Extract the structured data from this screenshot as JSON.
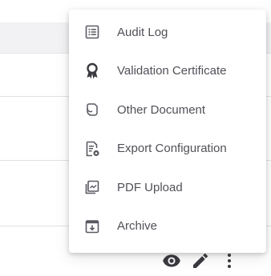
{
  "menu": {
    "items": [
      {
        "label": "Audit Log",
        "icon": "list-icon"
      },
      {
        "label": "Validation Certificate",
        "icon": "certificate-icon"
      },
      {
        "label": "Other Document",
        "icon": "document-icon"
      },
      {
        "label": "Export Configuration",
        "icon": "export-config-icon"
      },
      {
        "label": "PDF Upload",
        "icon": "pdf-upload-icon"
      },
      {
        "label": "Archive",
        "icon": "archive-icon"
      }
    ]
  },
  "row_actions": {
    "icons": [
      "eye-icon",
      "pencil-icon",
      "more-vertical-icon"
    ]
  },
  "colors": {
    "icon": "#5a5a62",
    "text": "#505058",
    "action_icon": "#3a3a40"
  }
}
